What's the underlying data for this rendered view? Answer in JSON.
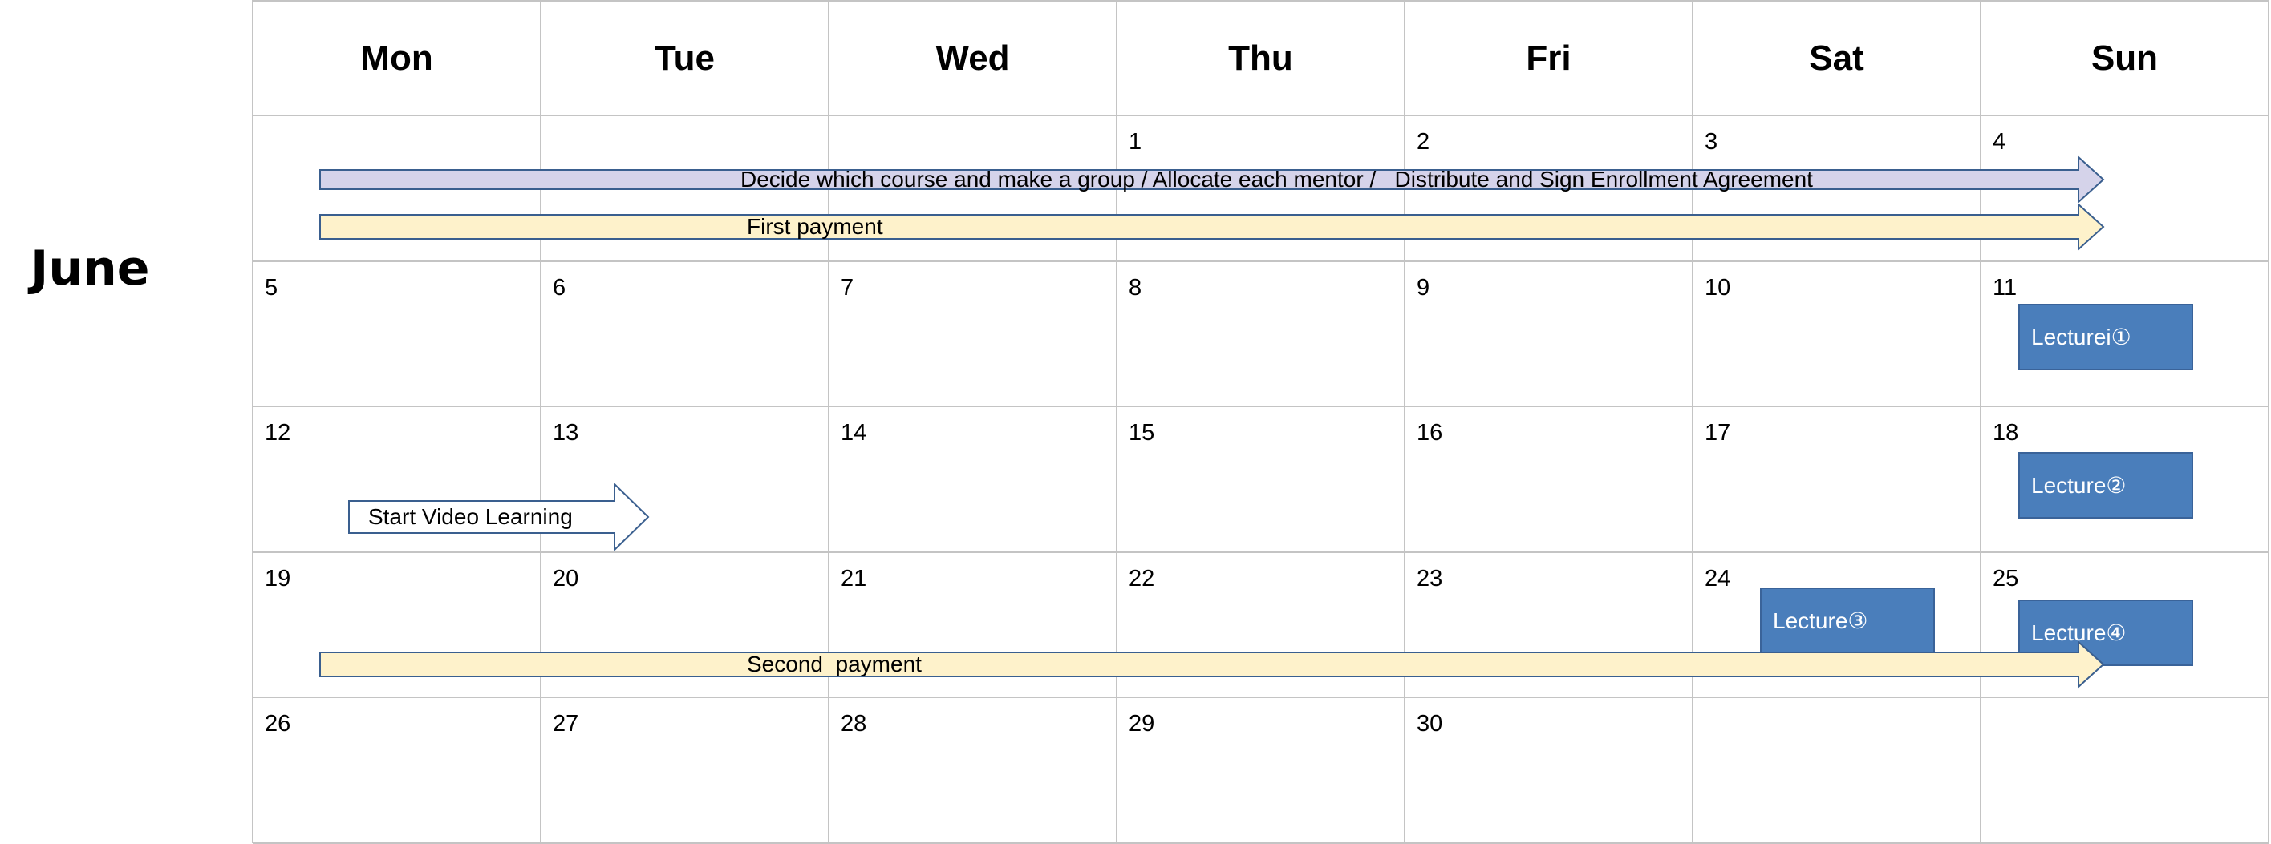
{
  "month": "June",
  "weekdays": [
    "Mon",
    "Tue",
    "Wed",
    "Thu",
    "Fri",
    "Sat",
    "Sun"
  ],
  "weeks": [
    [
      "",
      "",
      "",
      "1",
      "2",
      "3",
      "4"
    ],
    [
      "5",
      "6",
      "7",
      "8",
      "9",
      "10",
      "11"
    ],
    [
      "12",
      "13",
      "14",
      "15",
      "16",
      "17",
      "18"
    ],
    [
      "19",
      "20",
      "21",
      "22",
      "23",
      "24",
      "25"
    ],
    [
      "26",
      "27",
      "28",
      "29",
      "30",
      "",
      ""
    ]
  ],
  "events": {
    "decide_course": "Decide which course and make a group / Allocate each mentor /   Distribute and Sign Enrollment Agreement",
    "first_payment": "First payment",
    "start_video": "Start Video Learning",
    "second_payment": "Second  payment",
    "lecture_1": "Lecturei①",
    "lecture_2": "Lecture②",
    "lecture_3": "Lecture③",
    "lecture_4": "Lecture④"
  },
  "colors": {
    "grid_line": "#c4c4c4",
    "arrow_outline": "#3a5f8f",
    "arrow_fill_lavender": "#d5d3ea",
    "arrow_fill_cream": "#fef2cb",
    "arrow_fill_white": "#ffffff",
    "lecture_fill": "#4a7ebb"
  }
}
